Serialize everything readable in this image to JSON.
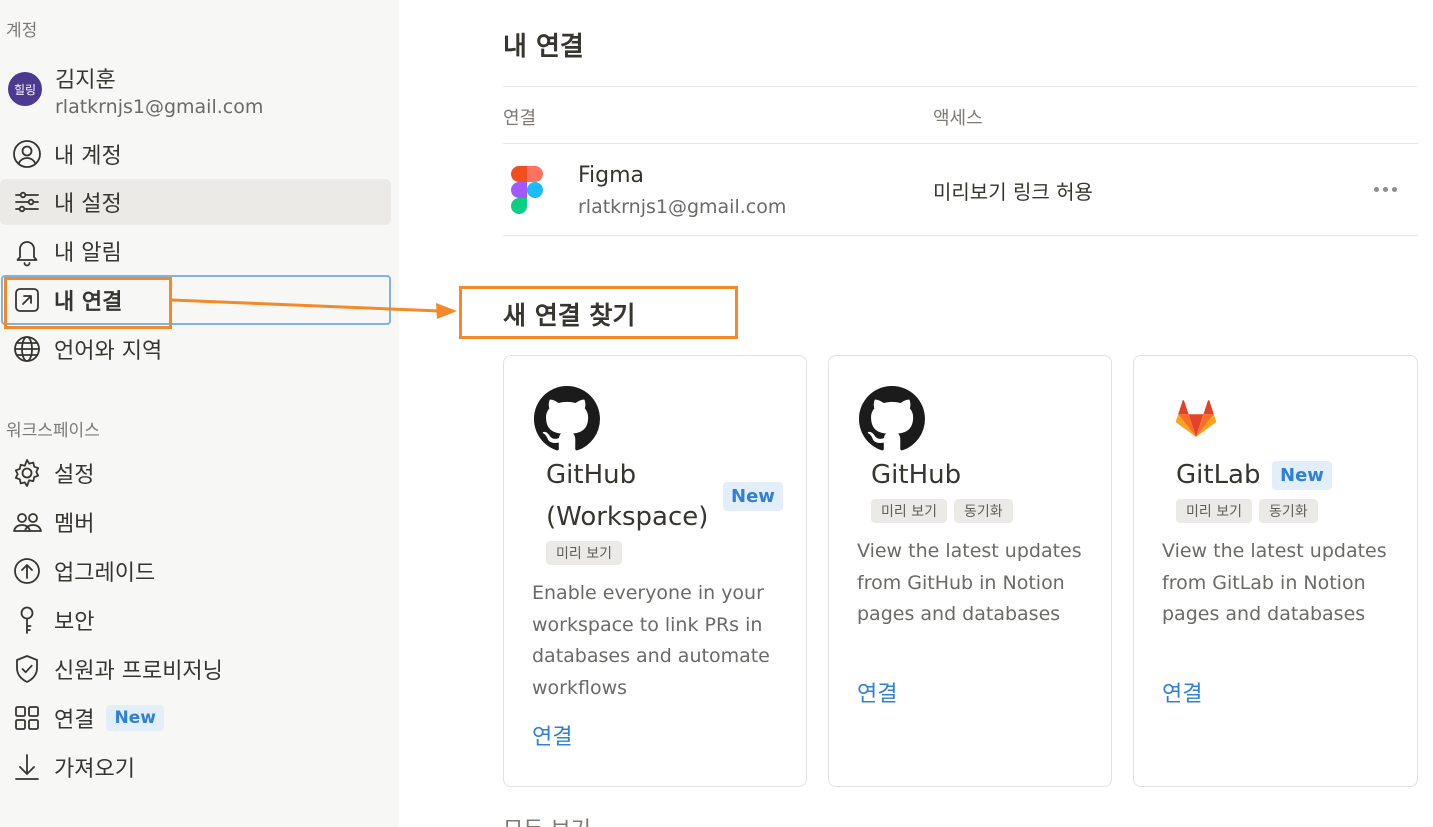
{
  "sidebar": {
    "account_label": "계정",
    "avatar_text": "힐링",
    "user_name": "김지훈",
    "user_email": "rlatkrnjs1@gmail.com",
    "account_items": [
      {
        "label": "내 계정",
        "icon": "user-circle-icon"
      },
      {
        "label": "내 설정",
        "icon": "sliders-icon"
      },
      {
        "label": "내 알림",
        "icon": "bell-icon"
      },
      {
        "label": "내 연결",
        "icon": "arrow-up-right-square-icon"
      },
      {
        "label": "언어와 지역",
        "icon": "globe-icon"
      }
    ],
    "workspace_label": "워크스페이스",
    "workspace_items": [
      {
        "label": "설정",
        "icon": "gear-icon"
      },
      {
        "label": "멤버",
        "icon": "people-icon"
      },
      {
        "label": "업그레이드",
        "icon": "arrow-up-circle-icon"
      },
      {
        "label": "보안",
        "icon": "key-icon"
      },
      {
        "label": "신원과 프로비저닝",
        "icon": "shield-check-icon"
      },
      {
        "label": "연결",
        "icon": "grid-icon",
        "badge": "New"
      },
      {
        "label": "가져오기",
        "icon": "download-icon"
      }
    ]
  },
  "main": {
    "title": "내 연결",
    "columns": {
      "connection": "연결",
      "access": "액세스"
    },
    "connections": [
      {
        "name": "Figma",
        "email": "rlatkrnjs1@gmail.com",
        "access": "미리보기 링크 허용",
        "icon": "figma-icon"
      }
    ],
    "find_title": "새 연결 찾기",
    "cards": [
      {
        "title_line1": "GitHub",
        "title_line2": "(Workspace)",
        "badge": "New",
        "tags": [
          "미리 보기"
        ],
        "description": "Enable everyone in your workspace to link PRs in databases and automate workflows",
        "link": "연결",
        "icon": "github-icon"
      },
      {
        "title_line1": "GitHub",
        "tags": [
          "미리 보기",
          "동기화"
        ],
        "description": "View the latest updates from GitHub in Notion pages and databases",
        "link": "연결",
        "icon": "github-icon"
      },
      {
        "title_line1": "GitLab",
        "badge": "New",
        "tags": [
          "미리 보기",
          "동기화"
        ],
        "description": "View the latest updates from GitLab in Notion pages and databases",
        "link": "연결",
        "icon": "gitlab-icon"
      }
    ],
    "all_view": "모두 보기"
  },
  "colors": {
    "annotation": "#f2892b",
    "link": "#2f80d6",
    "sidebar_bg": "#f7f7f5"
  }
}
